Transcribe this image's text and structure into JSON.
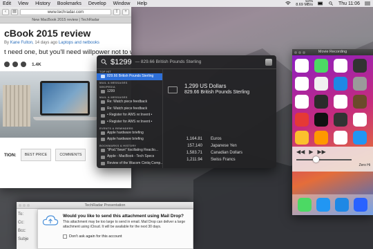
{
  "menubar": {
    "items": [
      "Edit",
      "View",
      "History",
      "Bookmarks",
      "Develop",
      "Window",
      "Help"
    ],
    "status_top": "93%",
    "status_bottom": "8.69 MB/s",
    "clock": "Thu 11:06"
  },
  "safari": {
    "url": "www.techradar.com",
    "tab_title": "New MacBook 2015 review | TechRadar",
    "article_title": "cBook 2015 review",
    "byline_by": "By",
    "byline_author": "Kane Fulton,",
    "byline_time": "14 days ago",
    "byline_section": "Laptops and netbooks",
    "lead": "t need one, but you'll need willpower not to want one",
    "share_count": "1.4K",
    "cta_label": "TION:",
    "cta_buttons": [
      "BEST PRICE",
      "COMMENTS"
    ]
  },
  "spotlight": {
    "query": "$1299",
    "query_suffix": "— 829.66 British Pounds Sterling",
    "sections": [
      {
        "head": "TOP HIT",
        "items": [
          {
            "label": "829.66 British Pounds Sterling",
            "selected": true
          }
        ]
      },
      {
        "head": "MAIL & MESSAGES",
        "items": []
      },
      {
        "head": "WIKIPEDIA",
        "items": [
          {
            "label": "1299",
            "selected": false
          }
        ]
      },
      {
        "head": "MAIL & MESSAGES",
        "items": [
          {
            "label": "Re: Watch piece feedback",
            "selected": false
          },
          {
            "label": "Re: Watch piece feedback",
            "selected": false
          },
          {
            "label": "• Register for AWS re:Invent •",
            "selected": false
          },
          {
            "label": "• Register for AWS re:Invent •",
            "selected": false
          }
        ]
      },
      {
        "head": "EVENTS & REMINDERS",
        "items": [
          {
            "label": "Apple hardware briefing",
            "selected": false
          },
          {
            "label": "Apple hardware briefing",
            "selected": false
          }
        ]
      },
      {
        "head": "BOOKMARKS & HISTORY",
        "items": [
          {
            "label": "\"iPod.\"/iewn\" \\tscillating Reaclio...",
            "selected": false
          },
          {
            "label": "Apple - MacBook - Tech Specs",
            "selected": false
          },
          {
            "label": "Review of the Wacom Cintiq Comp...",
            "selected": false
          }
        ]
      }
    ],
    "detail_line1": "1,299 US Dollars",
    "detail_line2": "829.66 British Pounds Sterling",
    "conversions": [
      {
        "amount": "1,164.81",
        "currency": "Euros"
      },
      {
        "amount": "157,140",
        "currency": "Japanese Yen"
      },
      {
        "amount": "1,583.71",
        "currency": "Canadian Dollars"
      },
      {
        "amount": "1,211.94",
        "currency": "Swiss Francs"
      }
    ]
  },
  "quicktime": {
    "title": "Movie Recording",
    "volume_text": "Zero Hi"
  },
  "mail": {
    "title": "TechRadar Presentation",
    "fields": [
      "To:",
      "Cc:",
      "Bcc:",
      "Subje"
    ],
    "sheet_title": "Would you like to send this attachment using Mail Drop?",
    "sheet_body": "This attachment may be too large to send in email. Mail Drop can deliver a large attachment using iCloud. It will be available for the next 30 days.",
    "checkbox_label": "Don't ask again for this account"
  },
  "colors": {
    "spotlight_bg": "#222224",
    "selection": "#2e6fd8",
    "link": "#2a6ebb"
  }
}
